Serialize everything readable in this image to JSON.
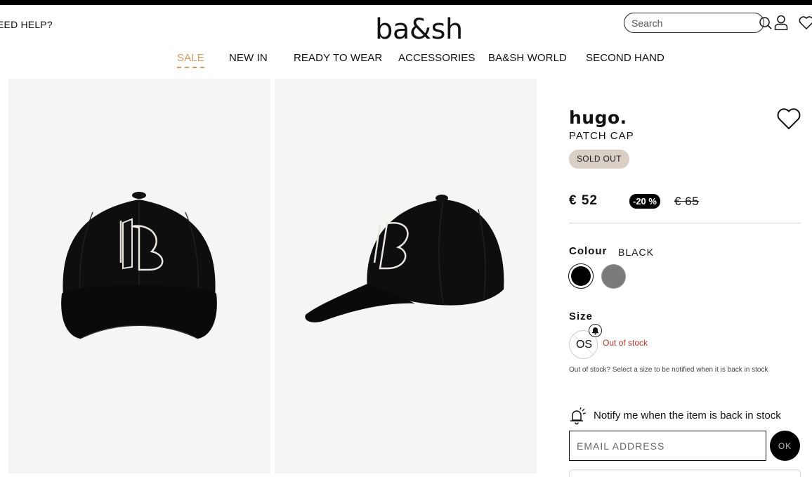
{
  "header": {
    "need_help": "EED HELP?",
    "logo": "ba&sh",
    "search_placeholder": "Search"
  },
  "nav": {
    "items": [
      {
        "label": "SALE"
      },
      {
        "label": "NEW IN"
      },
      {
        "label": "READY TO WEAR"
      },
      {
        "label": "ACCESSORIES"
      },
      {
        "label": "BA&SH WORLD"
      },
      {
        "label": "SECOND HAND"
      }
    ]
  },
  "product": {
    "brand": "hugo.",
    "name": "PATCH CAP",
    "badge": "SOLD OUT",
    "price": "€ 52",
    "discount": "-20 %",
    "old_price": "€ 65"
  },
  "colour": {
    "label": "Colour",
    "value": "BLACK",
    "swatches": [
      {
        "name": "black",
        "color": "#000000",
        "selected": true
      },
      {
        "name": "grey",
        "color": "#7a7a7a",
        "selected": false
      }
    ]
  },
  "size": {
    "label": "Size",
    "option": "OS",
    "status": "Out of stock",
    "hint": "Out of stock? Select a size to be notified when it is back in stock"
  },
  "notify": {
    "text": "Notify me when the item is back in stock",
    "email_placeholder": "EMAIL ADDRESS",
    "ok_label": "OK"
  },
  "colors": {
    "accent_sale": "#d59a5c",
    "badge_bg": "#d9cfc4",
    "out_of_stock": "#b8322d"
  }
}
